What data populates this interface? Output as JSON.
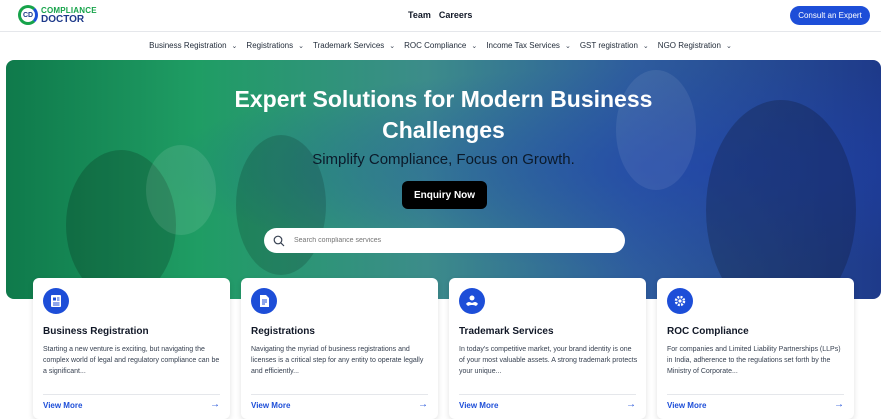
{
  "header": {
    "logo": {
      "mark": "CD",
      "line1": "COMPLIANCE",
      "line2": "DOCTOR"
    },
    "links": [
      "Team",
      "Careers"
    ],
    "cta_label": "Consult an Expert"
  },
  "nav": {
    "items": [
      {
        "label": "Business Registration"
      },
      {
        "label": "Registrations"
      },
      {
        "label": "Trademark Services"
      },
      {
        "label": "ROC Compliance"
      },
      {
        "label": "Income Tax Services"
      },
      {
        "label": "GST registration"
      },
      {
        "label": "NGO Registration"
      }
    ],
    "chevron_icon": "chevron-down-icon"
  },
  "hero": {
    "title": "Expert Solutions for Modern Business Challenges",
    "subtitle": "Simplify Compliance, Focus on Growth.",
    "button_label": "Enquiry Now",
    "search_placeholder": "Search compliance services",
    "search_icon": "search-icon"
  },
  "cards": [
    {
      "title": "Business Registration",
      "description": "Starting a new venture is exciting, but navigating the complex world of legal and regulatory compliance can be a significant...",
      "link": "View More",
      "icon": "document-icon",
      "icon_color": "#1d4ed8"
    },
    {
      "title": "Registrations",
      "description": "Navigating the myriad of business registrations and licenses is a critical step for any entity to operate legally and efficiently...",
      "link": "View More",
      "icon": "certificate-icon",
      "icon_color": "#1d4ed8"
    },
    {
      "title": "Trademark Services",
      "description": "In today's competitive market, your brand identity is one of your most valuable assets. A strong trademark protects your unique...",
      "link": "View More",
      "icon": "handshake-icon",
      "icon_color": "#1d4ed8"
    },
    {
      "title": "ROC Compliance",
      "description": "For companies and Limited Liability Partnerships (LLPs) in India, adherence to the regulations set forth by the Ministry of Corporate...",
      "link": "View More",
      "icon": "gear-icon",
      "icon_color": "#1d4ed8"
    }
  ],
  "colors": {
    "accent": "#1d4ed8",
    "brand_green": "#16a34a",
    "brand_navy": "#1e3a8a"
  }
}
